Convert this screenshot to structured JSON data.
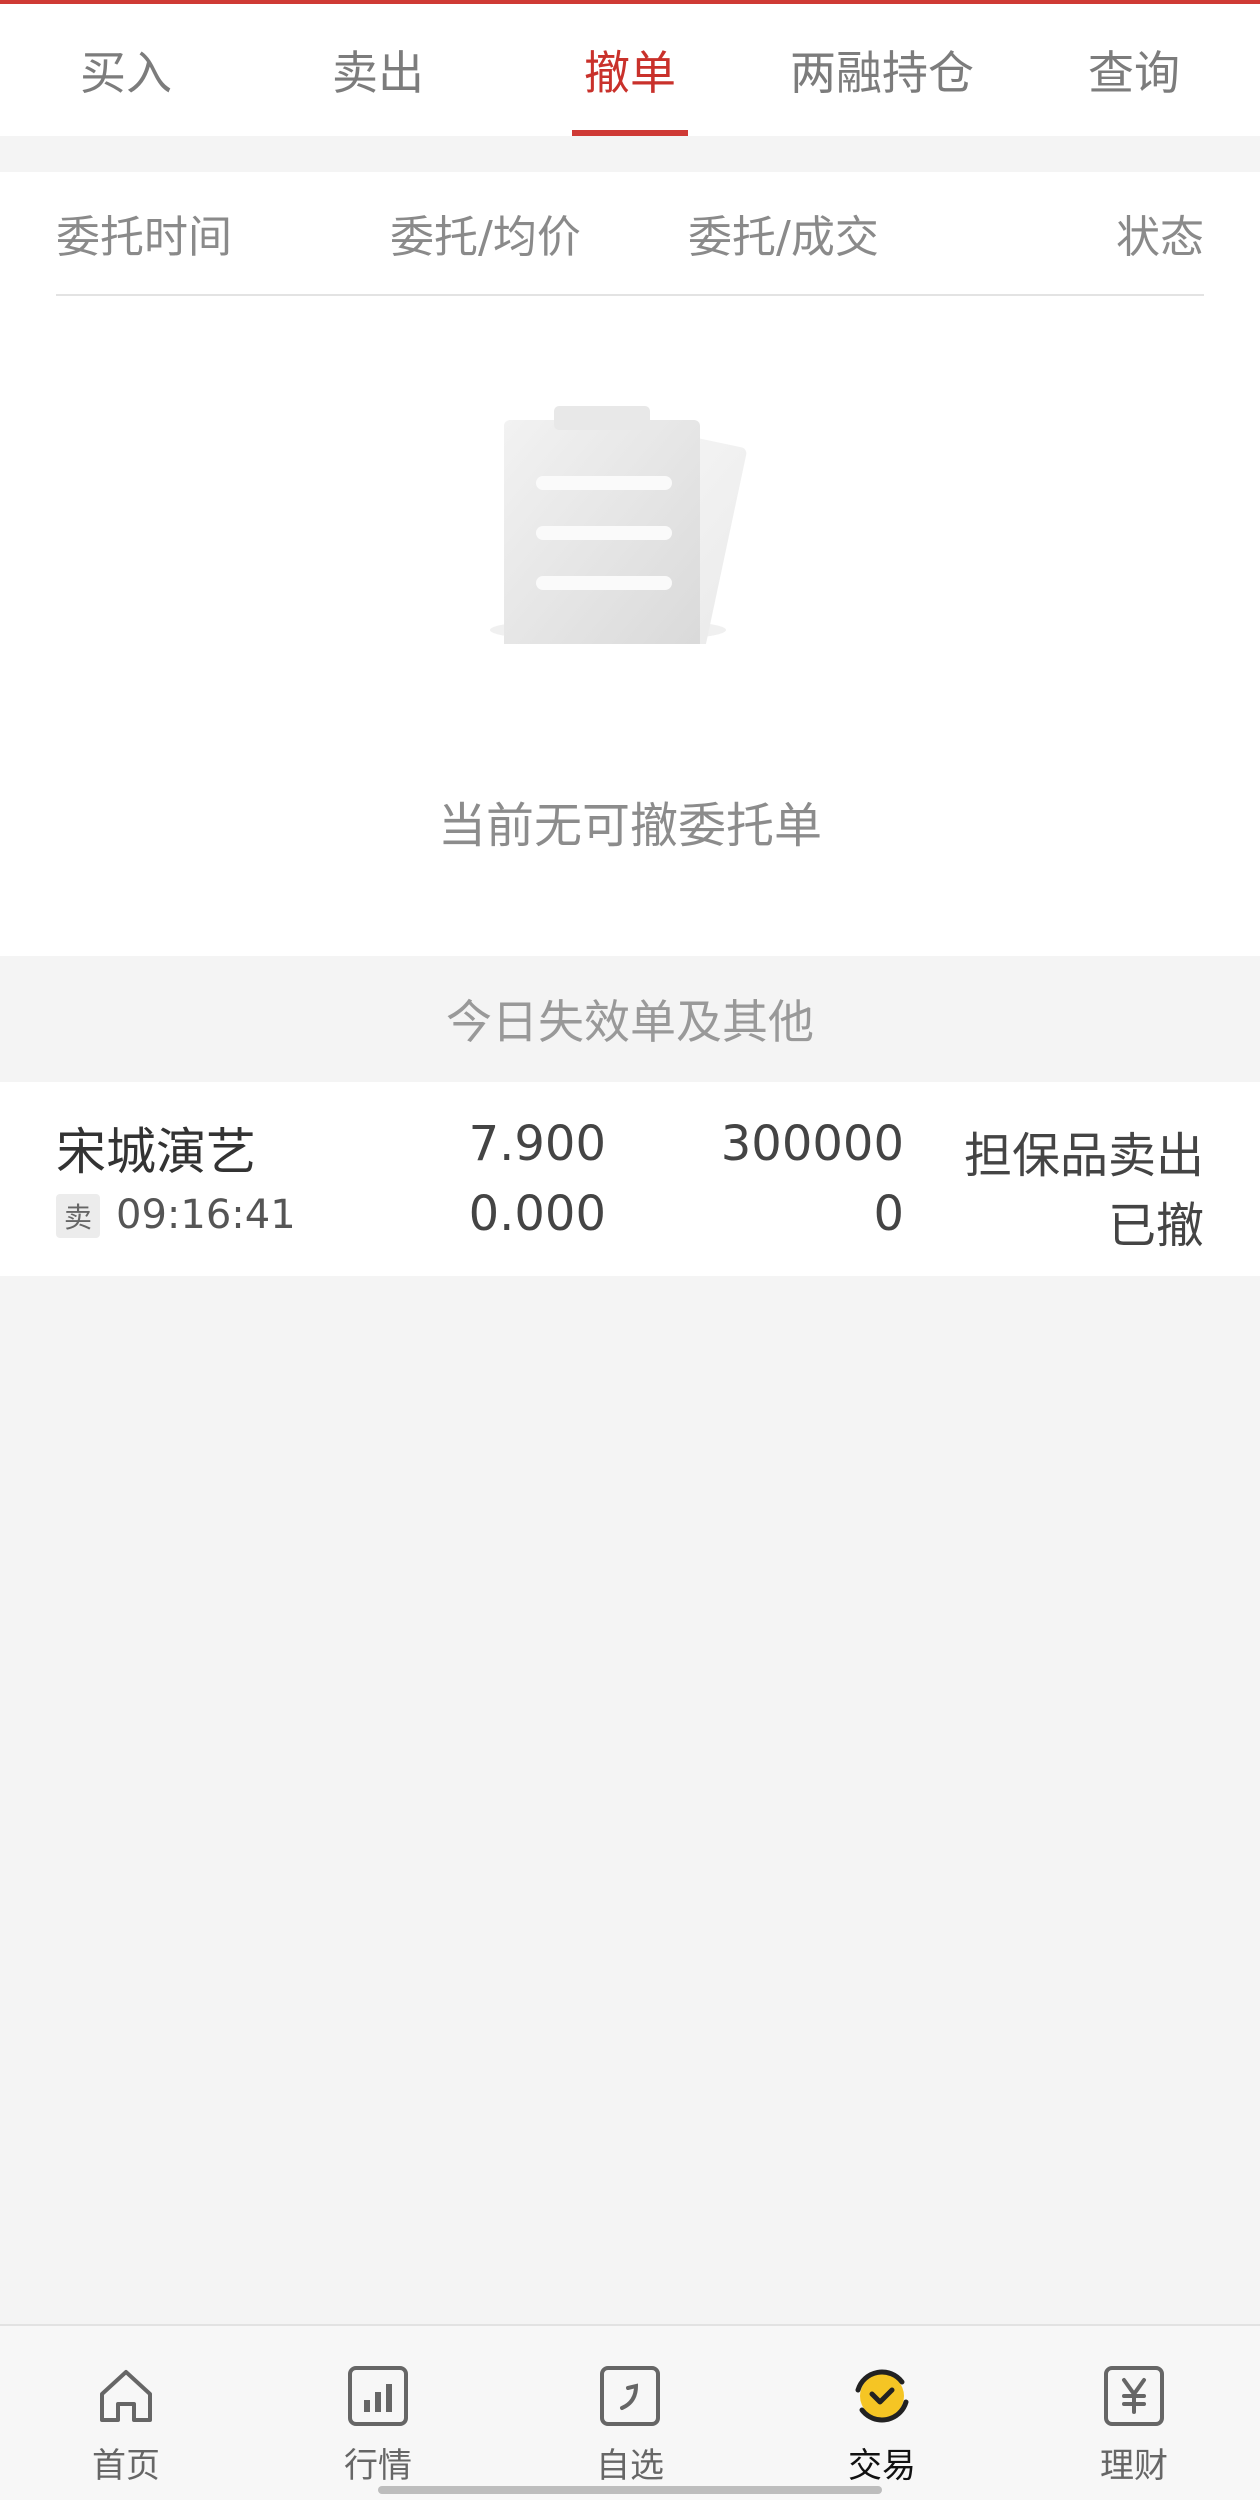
{
  "tabs": [
    {
      "label": "买入"
    },
    {
      "label": "卖出"
    },
    {
      "label": "撤单"
    },
    {
      "label": "两融持仓"
    },
    {
      "label": "查询"
    }
  ],
  "active_tab_index": 2,
  "columns": [
    "委托时间",
    "委托/均价",
    "委托/成交",
    "状态"
  ],
  "empty_state": {
    "message": "当前无可撤委托单",
    "icon": "clipboard-empty-icon"
  },
  "section_title": "今日失效单及其他",
  "orders": [
    {
      "name": "宋城演艺",
      "side": "卖",
      "time": "09:16:41",
      "order_price": "7.900",
      "avg_price": "0.000",
      "order_qty": "300000",
      "filled_qty": "0",
      "type": "担保品卖出",
      "status": "已撤"
    }
  ],
  "bottom_nav": [
    {
      "label": "首页",
      "icon": "home-icon"
    },
    {
      "label": "行情",
      "icon": "market-chart-icon"
    },
    {
      "label": "自选",
      "icon": "watchlist-icon"
    },
    {
      "label": "交易",
      "icon": "trade-icon"
    },
    {
      "label": "理财",
      "icon": "wealth-yen-icon"
    }
  ],
  "active_nav_index": 3,
  "colors": {
    "accent": "#cf3a35",
    "trade_icon": "#f5c524"
  }
}
